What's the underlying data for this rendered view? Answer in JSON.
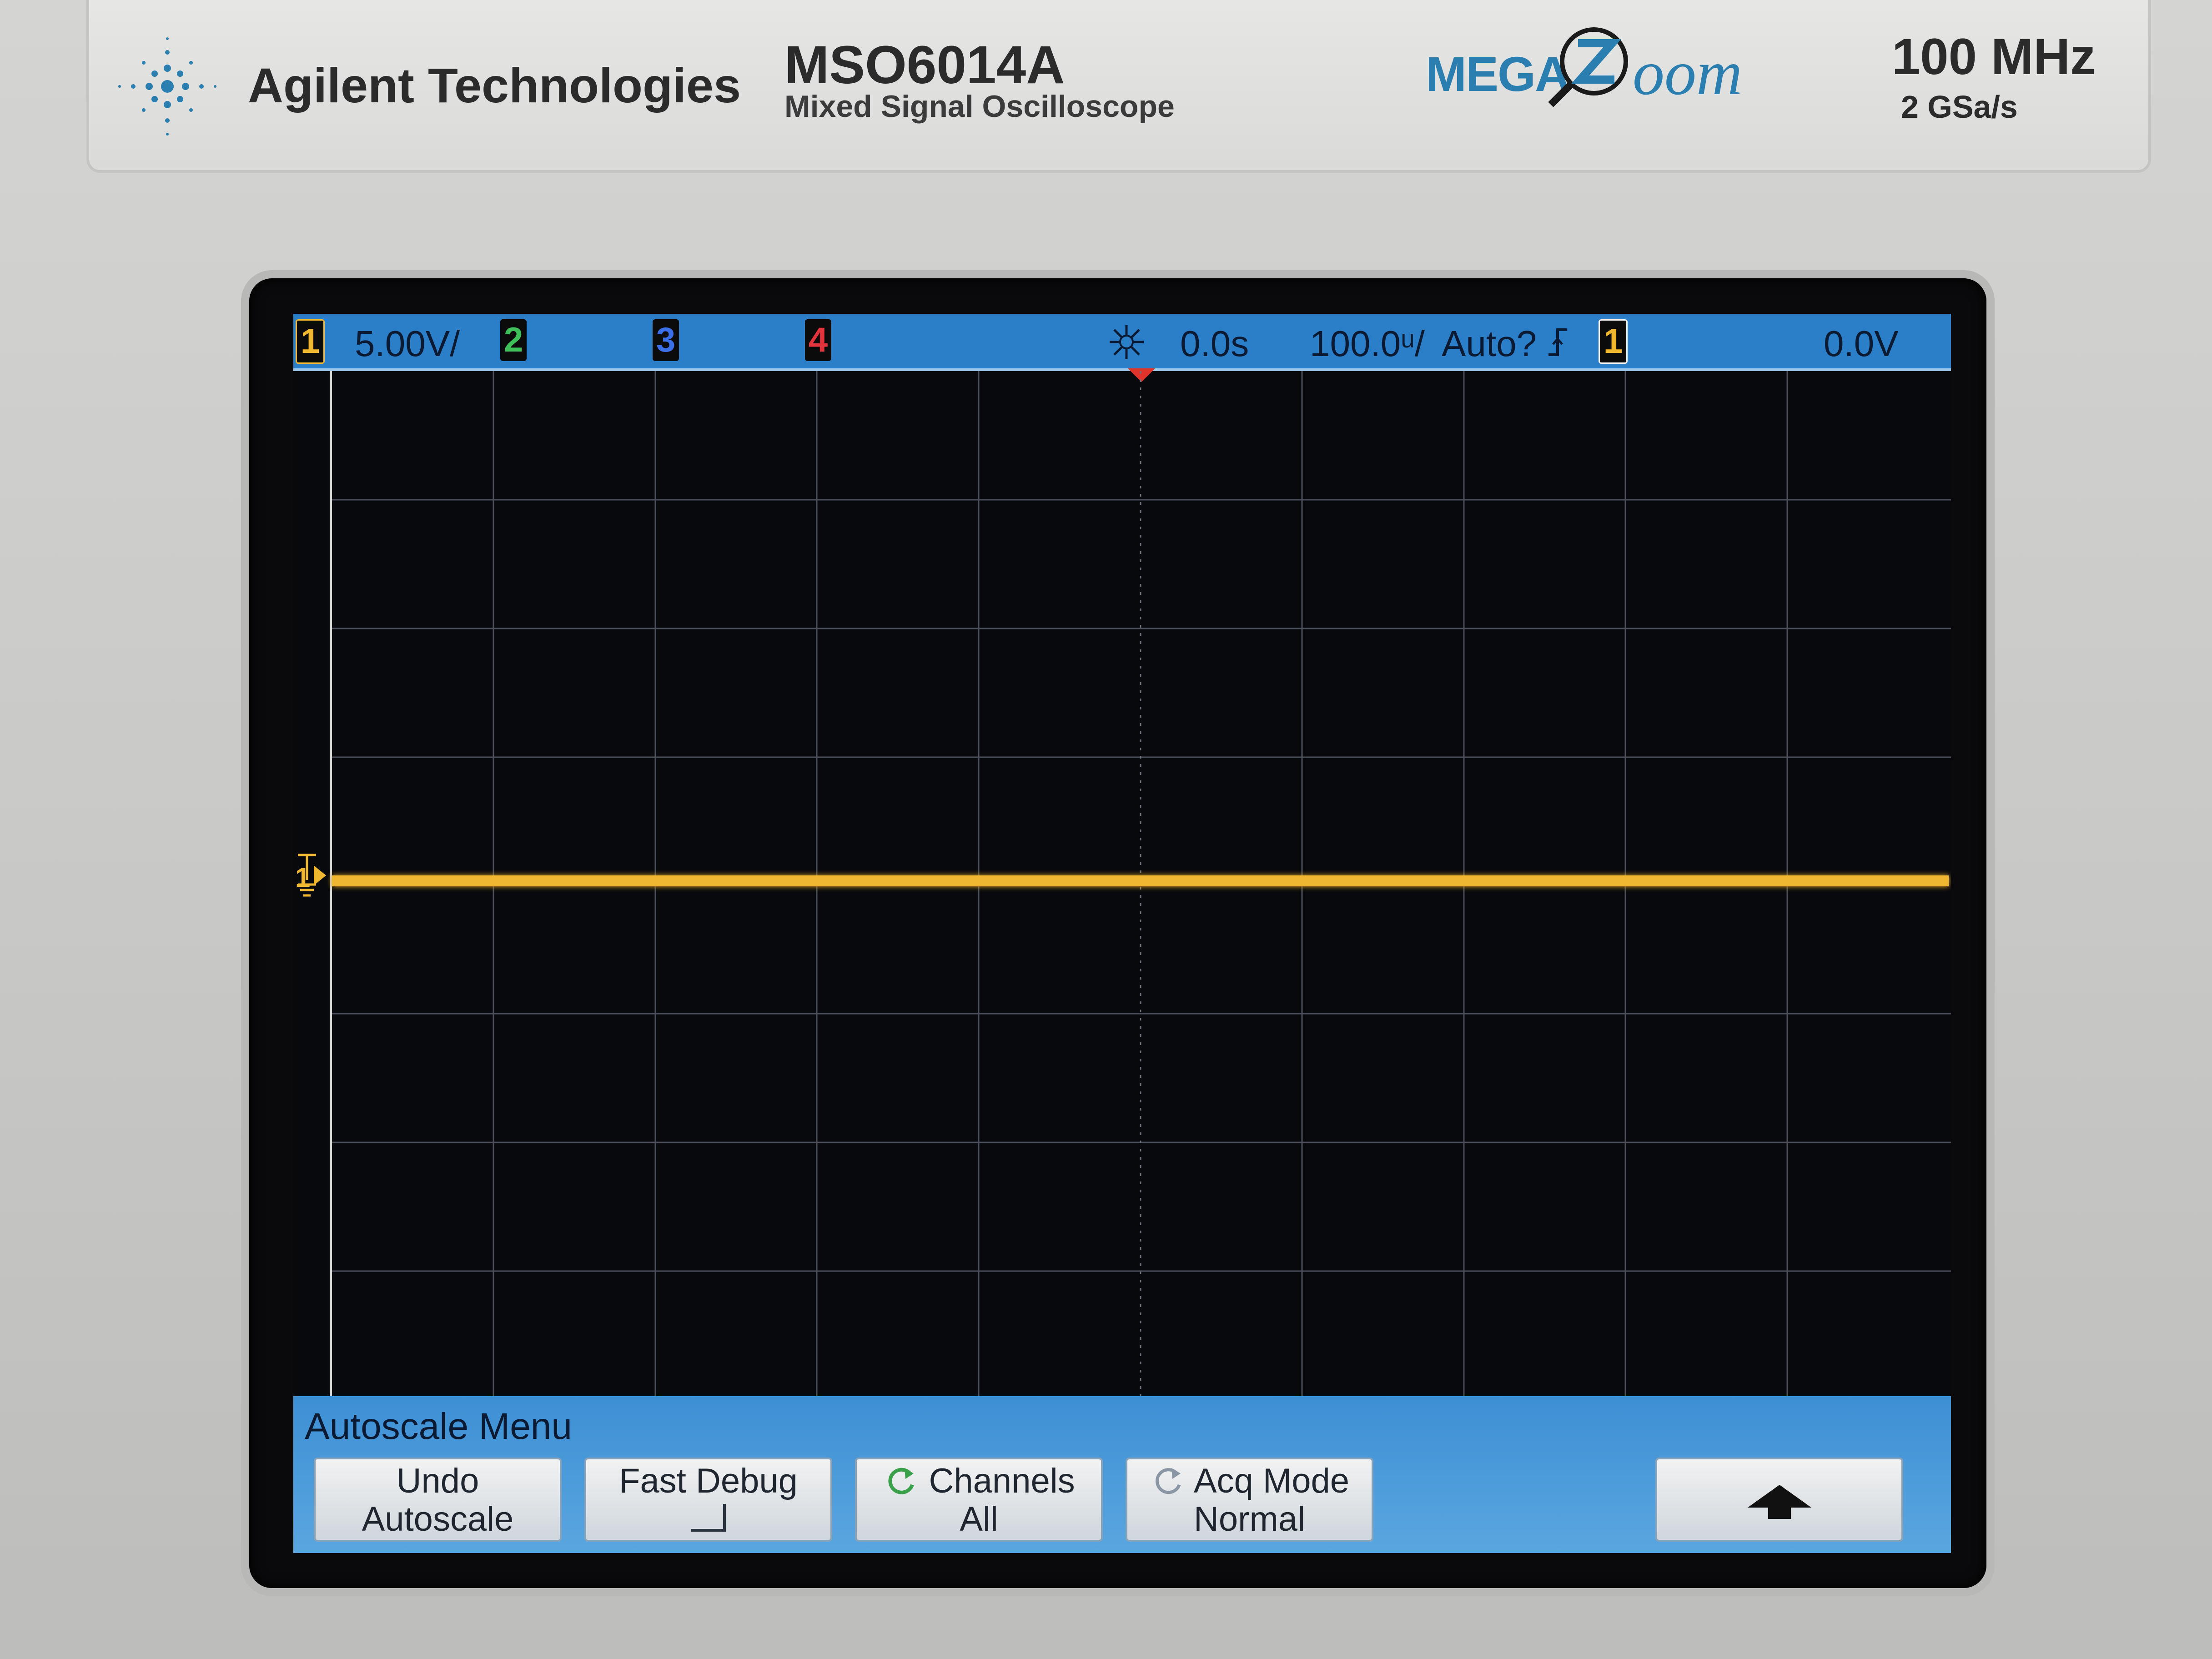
{
  "header": {
    "brand": "Agilent Technologies",
    "model": "MSO6014A",
    "model_subtitle": "Mixed Signal Oscilloscope",
    "megazoom_left": "MEGA",
    "megazoom_right": "oom",
    "bandwidth": "100 MHz",
    "sample_rate": "2  GSa/s"
  },
  "status": {
    "ch1": "1",
    "ch1_scale": "5.00V/",
    "ch2": "2",
    "ch3": "3",
    "ch4": "4",
    "time_delay": "0.0s",
    "time_scale": "100.0ᵘ/",
    "trigger_mode": "Auto?",
    "trigger_source": "1",
    "trigger_level": "0.0V"
  },
  "trace": {
    "channel_label": "1",
    "color": "#f0b830"
  },
  "menu": {
    "title": "Autoscale Menu",
    "softkeys": [
      {
        "line1": "Undo",
        "line2": "Autoscale"
      },
      {
        "line1": "Fast Debug",
        "line2": ""
      },
      {
        "line1": "Channels",
        "line2": "All"
      },
      {
        "line1": "Acq Mode",
        "line2": "Normal"
      }
    ]
  },
  "colors": {
    "ch1": "#f0b830",
    "ch2": "#3fbf5a",
    "ch3": "#3a6fe8",
    "ch4": "#e0333b",
    "statusbar": "#2b7fc9"
  }
}
